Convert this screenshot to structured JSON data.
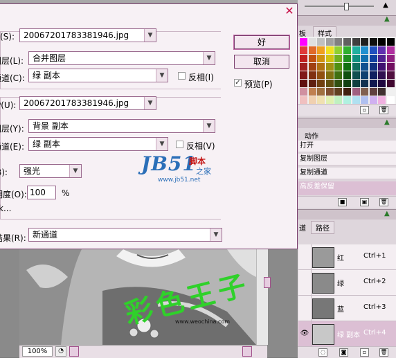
{
  "dialog": {
    "source1_label": "(S):",
    "source1_value": "20067201783381946.jpg",
    "layer1_label": "图层(L):",
    "layer1_value": "合并图层",
    "channel1_label": "通道(C):",
    "channel1_value": "绿 副本",
    "invert1_label": "反相(I)",
    "source2_label": "P(U):",
    "source2_value": "20067201783381946.jpg",
    "layer2_label": "图层(Y):",
    "layer2_value": "背景 副本",
    "channel2_label": "通道(E):",
    "channel2_value": "绿 副本",
    "invert2_label": "反相(V)",
    "blend_label": "B):",
    "blend_value": "强光",
    "opacity_label": "明度(O):",
    "opacity_value": "100",
    "opacity_unit": "%",
    "mask_label": "k...",
    "result_label": "结果(R):",
    "result_value": "新通道",
    "ok_label": "好",
    "cancel_label": "取消",
    "preview_label": "预览(P)",
    "preview_checked": true
  },
  "watermark": {
    "logo": "JB51",
    "cn1": "脚本",
    "cn2": "之家",
    "url": "www.jb51.net"
  },
  "photo": {
    "overlay_text": "彩色王子",
    "site": "www.weochina.com",
    "zoom": "100%"
  },
  "panels": {
    "swatches_tab": "板",
    "styles_tab": "样式",
    "actions_tab": "动作",
    "actions": [
      "打开",
      "复制图层",
      "复制通道",
      "高反差保留"
    ],
    "channels_tab": "道",
    "paths_tab": "路径",
    "channels": [
      {
        "name": "红",
        "shortcut": "Ctrl+1"
      },
      {
        "name": "绿",
        "shortcut": "Ctrl+2"
      },
      {
        "name": "蓝",
        "shortcut": "Ctrl+3"
      },
      {
        "name": "绿 副本",
        "shortcut": "Ctrl+4"
      }
    ]
  },
  "colors": {
    "accent": "#7a3e6e",
    "selected_row": "#dcbfd4",
    "close": "#c8154b",
    "overlay_green": "#2fd12a",
    "watermark_blue": "#2b6fb8"
  }
}
